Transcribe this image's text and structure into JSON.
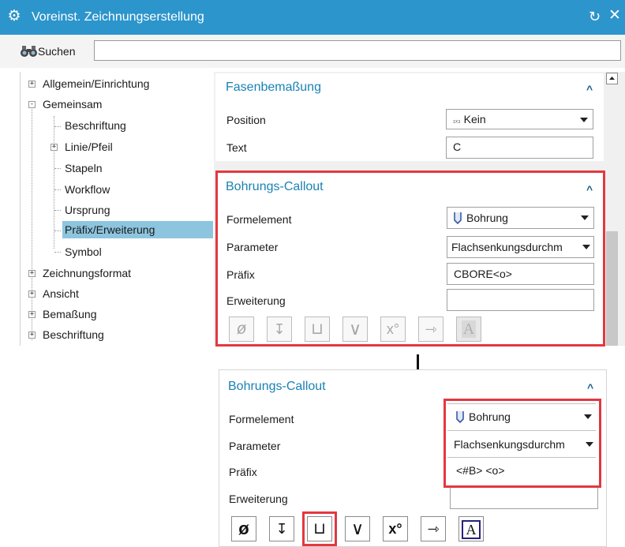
{
  "window": {
    "title": "Voreinst. Zeichnungserstellung"
  },
  "search": {
    "label": "Suchen",
    "value": ""
  },
  "tree": {
    "items": [
      {
        "label": "Allgemein/Einrichtung",
        "expander": "+"
      },
      {
        "label": "Gemeinsam",
        "expander": "-"
      },
      {
        "label": "Beschriftung"
      },
      {
        "label": "Linie/Pfeil",
        "expander": "+"
      },
      {
        "label": "Stapeln"
      },
      {
        "label": "Workflow"
      },
      {
        "label": "Ursprung"
      },
      {
        "label": "Präfix/Erweiterung",
        "selected": true
      },
      {
        "label": "Symbol"
      },
      {
        "label": "Zeichnungsformat",
        "expander": "+"
      },
      {
        "label": "Ansicht",
        "expander": "+"
      },
      {
        "label": "Bemaßung",
        "expander": "+"
      },
      {
        "label": "Beschriftung",
        "expander": "+"
      }
    ]
  },
  "fasen": {
    "title": "Fasenbemaßung",
    "position_label": "Position",
    "position_value": "Kein",
    "text_label": "Text",
    "text_value": "C"
  },
  "callout_top": {
    "title": "Bohrungs-Callout",
    "formelement_label": "Formelement",
    "formelement_value": "Bohrung",
    "parameter_label": "Parameter",
    "parameter_value": "Flachsenkungsdurchm",
    "praefix_label": "Präfix",
    "praefix_value": "CBORE<o>",
    "erweiterung_label": "Erweiterung",
    "erweiterung_value": ""
  },
  "callout_bottom": {
    "title": "Bohrungs-Callout",
    "formelement_label": "Formelement",
    "formelement_value": "Bohrung",
    "parameter_label": "Parameter",
    "parameter_value": "Flachsenkungsdurchm",
    "praefix_label": "Präfix",
    "praefix_value": "<#B> <o>",
    "erweiterung_label": "Erweiterung",
    "erweiterung_value": ""
  },
  "toolbar_symbols": {
    "diameter": "ø",
    "depth": "↧",
    "counterbore": "⊔",
    "countersink": "∨",
    "degree": "x°",
    "arrow": "⇾",
    "text": "A"
  },
  "colors": {
    "titlebar": "#2c95cc",
    "section_title": "#1a82b4",
    "highlight_red": "#e3383f",
    "selection": "#8dc5df"
  }
}
